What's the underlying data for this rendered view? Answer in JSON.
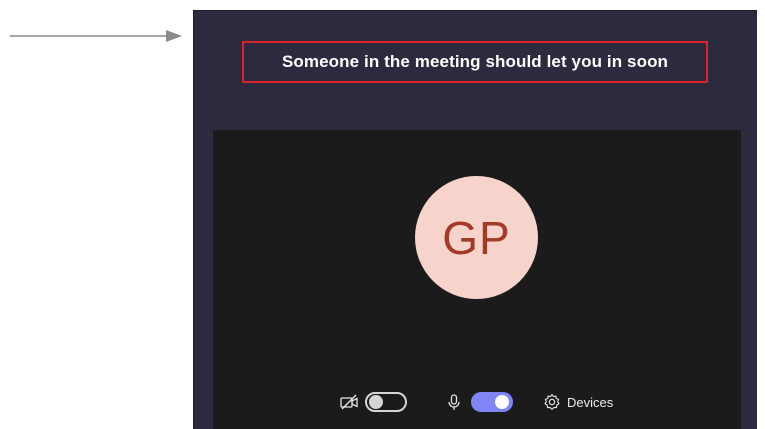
{
  "lobby": {
    "message": "Someone in the meeting should let you in soon"
  },
  "participant": {
    "initials": "GP"
  },
  "controls": {
    "camera": {
      "icon": "camera-off-icon",
      "enabled": false
    },
    "microphone": {
      "icon": "microphone-icon",
      "enabled": true
    },
    "devices": {
      "icon": "gear-icon",
      "label": "Devices"
    }
  },
  "colors": {
    "window_bg": "#2b2a3e",
    "preview_bg": "#1b1b1b",
    "highlight_border": "#d8232a",
    "avatar_bg": "#f7d4cb",
    "avatar_text": "#a23a27",
    "toggle_on": "#7f85f5"
  }
}
